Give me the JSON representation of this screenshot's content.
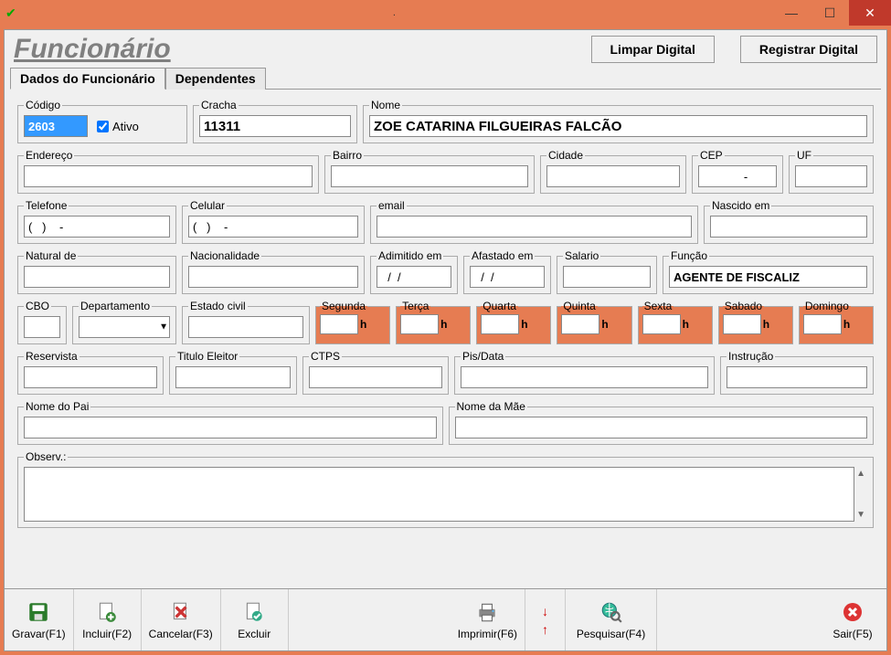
{
  "window": {
    "title": "."
  },
  "header": {
    "title": "Funcionário",
    "buttons": {
      "limpar": "Limpar Digital",
      "registrar": "Registrar Digital"
    }
  },
  "tabs": {
    "dados": "Dados do Funcionário",
    "dependentes": "Dependentes"
  },
  "fields": {
    "codigo": {
      "label": "Código",
      "value": "2603"
    },
    "ativo": {
      "label": "Ativo",
      "checked": true
    },
    "cracha": {
      "label": "Cracha",
      "value": "11311"
    },
    "nome": {
      "label": "Nome",
      "value": "ZOE CATARINA FILGUEIRAS FALCÃO"
    },
    "endereco": {
      "label": "Endereço",
      "value": ""
    },
    "bairro": {
      "label": "Bairro",
      "value": ""
    },
    "cidade": {
      "label": "Cidade",
      "value": ""
    },
    "cep": {
      "label": "CEP",
      "value": "     -"
    },
    "uf": {
      "label": "UF",
      "value": ""
    },
    "telefone": {
      "label": "Telefone",
      "value": "(   )    -"
    },
    "celular": {
      "label": "Celular",
      "value": "(   )    -"
    },
    "email": {
      "label": "email",
      "value": ""
    },
    "nascido": {
      "label": "Nascido em",
      "value": ""
    },
    "natural": {
      "label": "Natural de",
      "value": ""
    },
    "nacionalidade": {
      "label": "Nacionalidade",
      "value": ""
    },
    "admitido": {
      "label": "Adimitido em",
      "value": "  /  /"
    },
    "afastado": {
      "label": "Afastado em",
      "value": "  /  /"
    },
    "salario": {
      "label": "Salario",
      "value": ""
    },
    "funcao": {
      "label": "Função",
      "value": "AGENTE DE FISCALIZ"
    },
    "cbo": {
      "label": "CBO",
      "value": ""
    },
    "departamento": {
      "label": "Departamento",
      "value": ""
    },
    "estadocivil": {
      "label": "Estado civil",
      "value": ""
    },
    "reservista": {
      "label": "Reservista",
      "value": ""
    },
    "titulo": {
      "label": "Titulo Eleitor",
      "value": ""
    },
    "ctps": {
      "label": "CTPS",
      "value": ""
    },
    "pis": {
      "label": "Pis/Data",
      "value": ""
    },
    "instrucao": {
      "label": "Instrução",
      "value": ""
    },
    "nomepai": {
      "label": "Nome do Pai",
      "value": ""
    },
    "nomemae": {
      "label": "Nome da Mãe",
      "value": ""
    },
    "observ": {
      "label": "Observ.:",
      "value": ""
    }
  },
  "days": {
    "segunda": {
      "label": "Segunda",
      "h": "h"
    },
    "terca": {
      "label": "Terça",
      "h": "h"
    },
    "quarta": {
      "label": "Quarta",
      "h": "h"
    },
    "quinta": {
      "label": "Quinta",
      "h": "h"
    },
    "sexta": {
      "label": "Sexta",
      "h": "h"
    },
    "sabado": {
      "label": "Sabado",
      "h": "h"
    },
    "domingo": {
      "label": "Domingo",
      "h": "h"
    }
  },
  "toolbar": {
    "gravar": "Gravar(F1)",
    "incluir": "Incluir(F2)",
    "cancelar": "Cancelar(F3)",
    "excluir": "Excluir",
    "imprimir": "Imprimir(F6)",
    "pesquisar": "Pesquisar(F4)",
    "sair": "Sair(F5)"
  }
}
